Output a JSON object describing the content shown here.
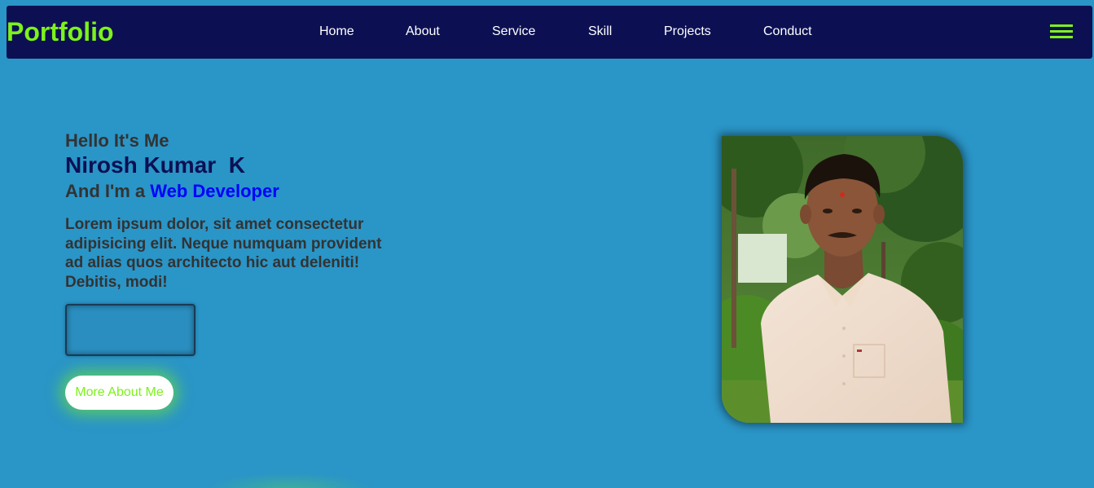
{
  "navbar": {
    "logo": "Portfolio",
    "links": [
      {
        "label": "Home"
      },
      {
        "label": "About"
      },
      {
        "label": "Service"
      },
      {
        "label": "Skill"
      },
      {
        "label": "Projects"
      },
      {
        "label": "Conduct"
      }
    ],
    "menu_icon": "hamburger-menu-icon"
  },
  "hero": {
    "greeting": "Hello It's Me",
    "name": "Nirosh Kumar  K",
    "role_prefix": "And I'm a ",
    "role": "Web Developer",
    "bio": "Lorem ipsum dolor, sit amet consectetur adipisicing elit. Neque numquam provident ad alias quos architecto hic aut deleniti! Debitis, modi!",
    "more_button": "More About Me"
  },
  "colors": {
    "page_background": "#2a95c7",
    "navbar_background": "#0c1053",
    "accent_green": "#7df21a",
    "name_color": "#0c1053",
    "role_color": "#0000ff",
    "text_dark": "#333333"
  }
}
